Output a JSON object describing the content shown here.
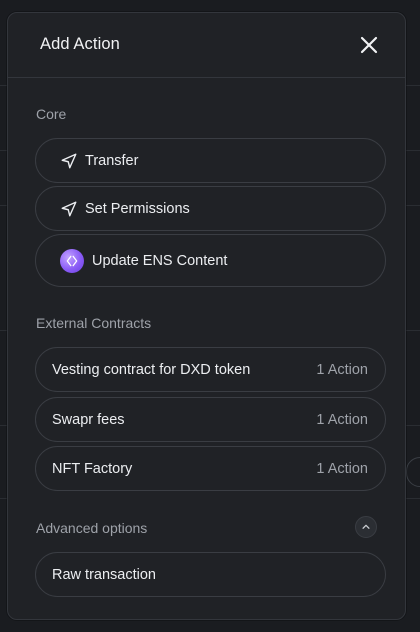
{
  "modal": {
    "title": "Add Action"
  },
  "sections": {
    "core": {
      "label": "Core",
      "items": [
        {
          "label": "Transfer",
          "icon": "send-icon"
        },
        {
          "label": "Set Permissions",
          "icon": "send-icon"
        },
        {
          "label": "Update ENS Content",
          "icon": "ens-icon"
        }
      ]
    },
    "external": {
      "label": "External Contracts",
      "items": [
        {
          "label": "Vesting contract for DXD token",
          "meta": "1 Action"
        },
        {
          "label": "Swapr fees",
          "meta": "1 Action"
        },
        {
          "label": "NFT Factory",
          "meta": "1 Action"
        }
      ]
    },
    "advanced": {
      "label": "Advanced options",
      "items": [
        {
          "label": "Raw transaction"
        }
      ]
    }
  },
  "colors": {
    "background": "#1a1c20",
    "modal": "#202226",
    "border": "#3a3d43",
    "text": "#eceef1",
    "muted": "#9ea2a9",
    "ens_accent": "#8a5cf6"
  }
}
